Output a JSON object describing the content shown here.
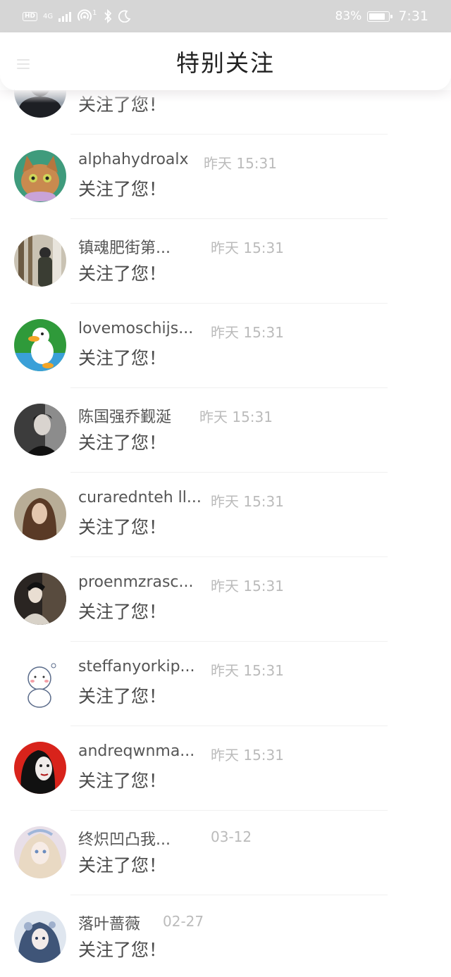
{
  "status_bar": {
    "hd": "HD",
    "network": "4G",
    "hotspot_count": "1",
    "battery_percent": "83%",
    "time": "7:31",
    "icons": [
      "hd-icon",
      "signal-icon",
      "hotspot-icon",
      "bluetooth-icon",
      "moon-icon",
      "battery-icon"
    ]
  },
  "header": {
    "title": "特别关注",
    "menu_icon": "menu-icon"
  },
  "items": [
    {
      "name": "",
      "time": "",
      "message": "关注了您！"
    },
    {
      "name": "alphahydroalx",
      "time": "昨天 15:31",
      "message": "关注了您！"
    },
    {
      "name": "镇魂肥街第...",
      "time": "昨天 15:31",
      "message": "关注了您！"
    },
    {
      "name": "lovemoschijs...",
      "time": "昨天 15:31",
      "message": "关注了您！"
    },
    {
      "name": "陈国强乔觐涎",
      "time": "昨天 15:31",
      "message": "关注了您！"
    },
    {
      "name": "curarednteh ll...",
      "time": "昨天 15:31",
      "message": "关注了您！"
    },
    {
      "name": "proenmzrasc...",
      "time": "昨天 15:31",
      "message": "关注了您！"
    },
    {
      "name": "steffanyorkip...",
      "time": "昨天 15:31",
      "message": "关注了您！"
    },
    {
      "name": "andreqwnma...",
      "time": "昨天 15:31",
      "message": "关注了您！"
    },
    {
      "name": "终炽凹凸我...",
      "time": "03-12",
      "message": "关注了您！"
    },
    {
      "name": "落叶蔷薇",
      "time": "02-27",
      "message": "关注了您！"
    }
  ]
}
